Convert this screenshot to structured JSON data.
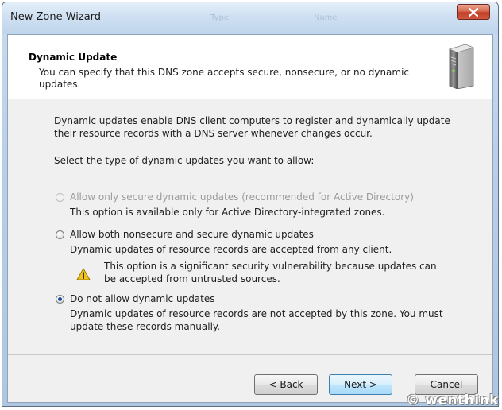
{
  "window": {
    "title": "New Zone Wizard",
    "faded_tabs": [
      "Type",
      "Name"
    ],
    "close_icon": "close-x-icon"
  },
  "header": {
    "title": "Dynamic Update",
    "description": "You can specify that this DNS zone accepts secure, nonsecure, or no dynamic updates.",
    "icon": "server-icon"
  },
  "body": {
    "intro": "Dynamic updates enable DNS client computers to register and dynamically update their resource records with a DNS server whenever changes occur.",
    "prompt": "Select the type of dynamic updates you want to allow:"
  },
  "options": [
    {
      "label": "Allow only secure dynamic updates (recommended for Active Directory)",
      "description": "This option is available only for Active Directory-integrated zones.",
      "enabled": false,
      "selected": false
    },
    {
      "label": "Allow both nonsecure and secure dynamic updates",
      "description": "Dynamic updates of resource records are accepted from any client.",
      "warning": "This option is a significant security vulnerability because updates can be accepted from untrusted sources.",
      "enabled": true,
      "selected": false
    },
    {
      "label": "Do not allow dynamic updates",
      "description": "Dynamic updates of resource records are not accepted by this zone. You must update these records manually.",
      "enabled": true,
      "selected": true
    }
  ],
  "buttons": {
    "back": "< Back",
    "next": "Next >",
    "cancel": "Cancel"
  },
  "watermark": "© wenthink",
  "colors": {
    "accent": "#1b4f9a",
    "close": "#c2402a",
    "warning": "#f2c318"
  }
}
